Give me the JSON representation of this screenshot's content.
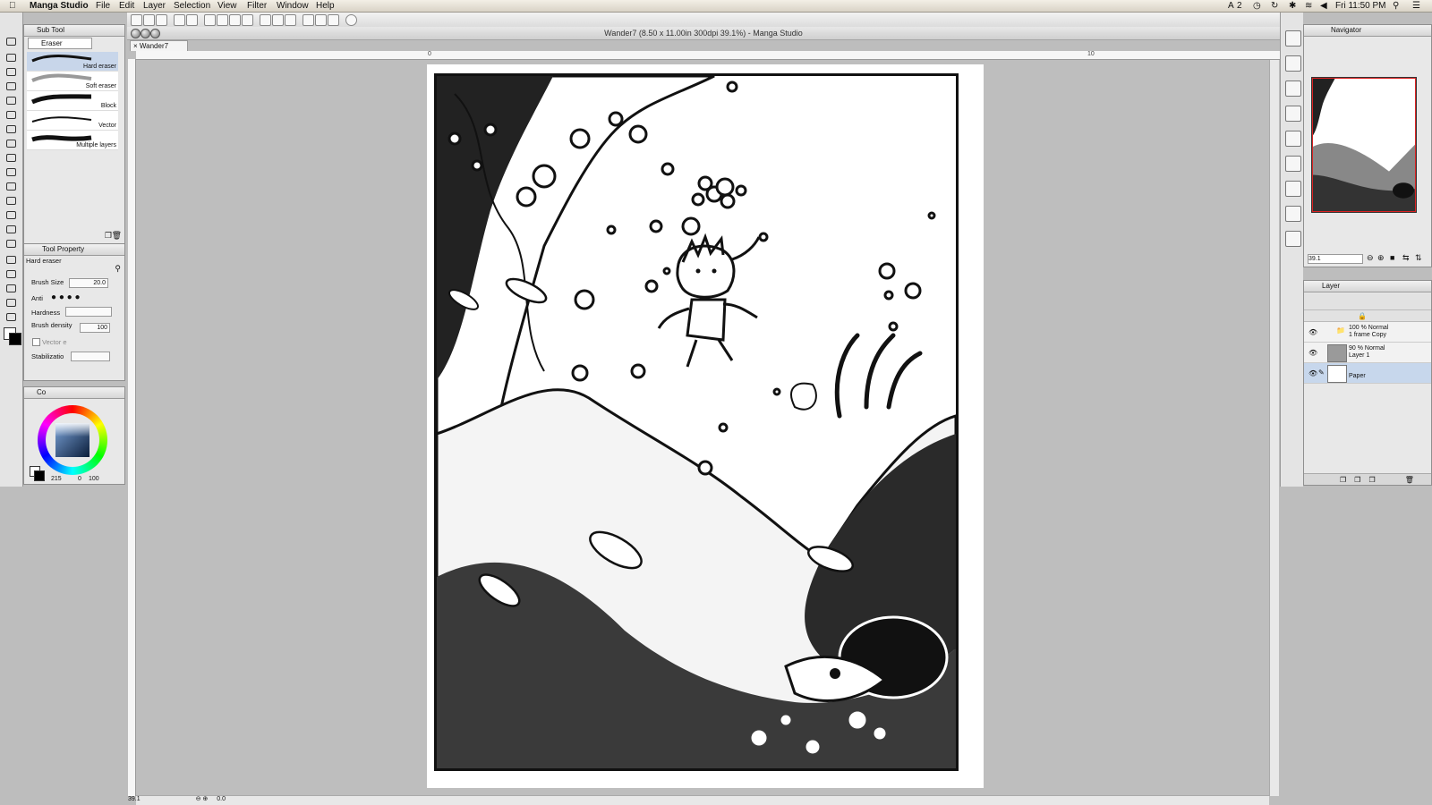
{
  "menubar": {
    "app_name": "Manga Studio",
    "items": [
      "File",
      "Edit",
      "Layer",
      "Selection",
      "View",
      "Filter",
      "Window",
      "Help"
    ],
    "status_badge": "2",
    "clock": "Fri 11:50 PM"
  },
  "document": {
    "window_title": "Wander7 (8.50 x 11.00in 300dpi 39.1%)  - Manga Studio",
    "tab": "Wander7"
  },
  "ruler": {
    "marks": [
      "0",
      "10"
    ]
  },
  "sub_tool": {
    "title": "Sub Tool",
    "active_tab": "Eraser",
    "brushes": [
      {
        "label": "Hard eraser"
      },
      {
        "label": "Soft eraser"
      },
      {
        "label": "Block"
      },
      {
        "label": "Vector"
      },
      {
        "label": "Multiple layers"
      }
    ]
  },
  "tool_property": {
    "title": "Tool Property",
    "preset": "Hard eraser",
    "brush_size_label": "Brush Size",
    "brush_size": "20.0",
    "anti_label": "Anti",
    "hardness_label": "Hardness",
    "density_label": "Brush density",
    "density": "100",
    "vector_label": "Vector e",
    "stabilization_label": "Stabilizatio"
  },
  "color": {
    "tab": "Co",
    "readout": "215",
    "readout2": "0",
    "readout3": "100",
    "selected_hex": "#1f3a5f"
  },
  "navigator": {
    "title": "Navigator",
    "zoom": "39.1",
    "rotation": "0.0"
  },
  "layer": {
    "title": "Layer",
    "layers": [
      {
        "line1": "100 % Normal",
        "line2": "1 frame Copy"
      },
      {
        "line1": "90 % Normal",
        "line2": "Layer 1"
      },
      {
        "line1": "",
        "line2": "Paper"
      }
    ]
  },
  "status": {
    "zoom": "39.1",
    "rotation": "0.0"
  }
}
